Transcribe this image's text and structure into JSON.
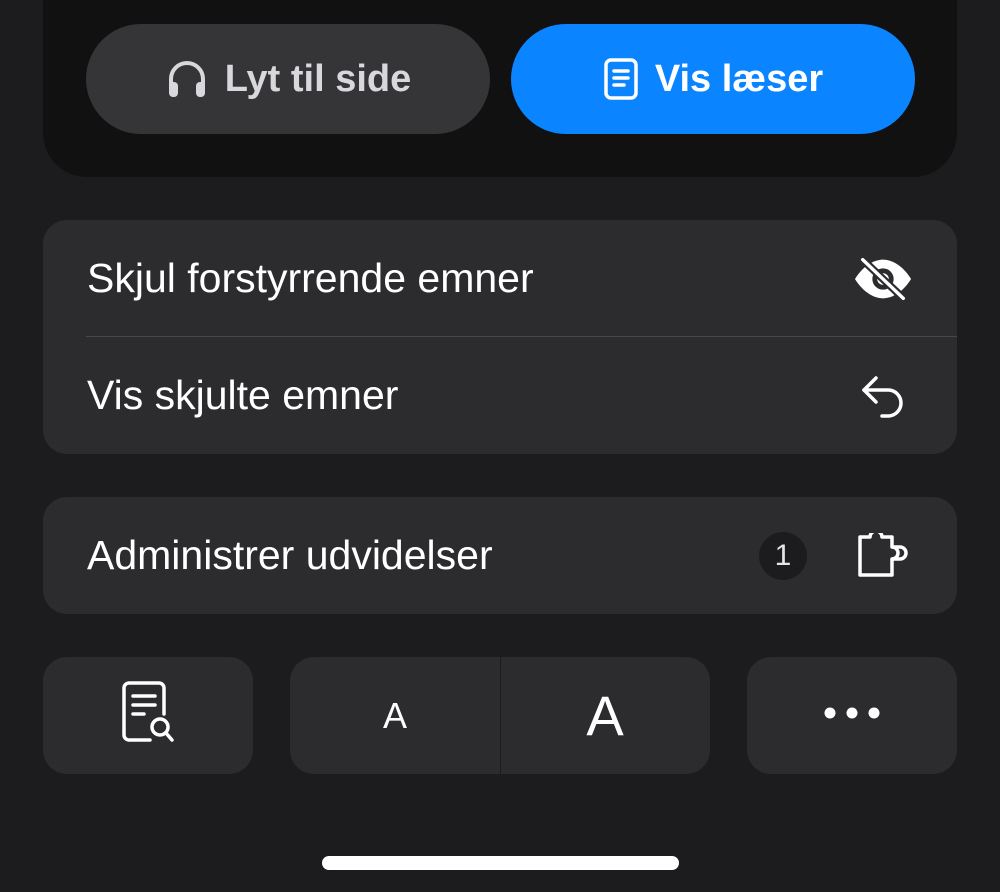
{
  "top_actions": {
    "listen": {
      "label": "Lyt til side",
      "icon": "headphones-icon"
    },
    "reader": {
      "label": "Vis læser",
      "icon": "reader-doc-icon",
      "color": "#0a84ff"
    }
  },
  "menu_group_1": {
    "items": [
      {
        "label": "Skjul forstyrrende emner",
        "icon": "eye-slash-icon"
      },
      {
        "label": "Vis skjulte emner",
        "icon": "undo-arrow-icon"
      }
    ]
  },
  "menu_group_2": {
    "items": [
      {
        "label": "Administrer udvidelser",
        "badge": "1",
        "icon": "puzzle-piece-icon"
      }
    ]
  },
  "bottom_tiles": {
    "find": {
      "icon": "find-in-page-icon"
    },
    "font_small": "A",
    "font_large": "A",
    "more": {
      "icon": "ellipsis-icon"
    }
  },
  "colors": {
    "background": "#1c1c1e",
    "panel": "#111112",
    "cell": "#2c2c2e",
    "accent": "#0a84ff"
  }
}
